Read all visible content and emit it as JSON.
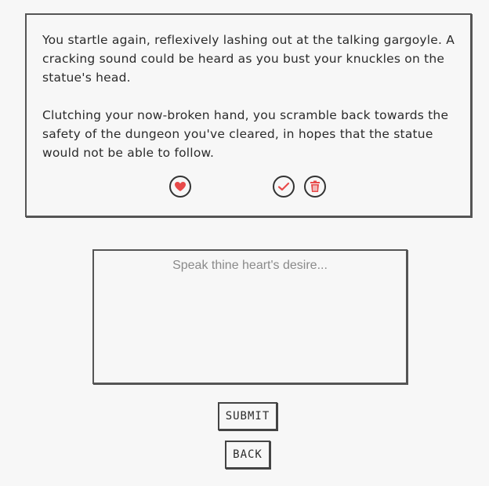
{
  "story": {
    "paragraphs": [
      "You startle again, reflexively lashing out at the talking gargoyle. A cracking sound could be heard as you bust your knuckles on the statue's head.",
      "Clutching your now-broken hand, you scramble back towards the safety of the dungeon you've cleared, in hopes that the statue would not be able to follow."
    ],
    "actions": [
      {
        "icon": "heart-icon",
        "color": "#e84a4a"
      },
      {
        "icon": "check-icon",
        "color": "#e84a4a"
      },
      {
        "icon": "trash-icon",
        "color": "#e84a4a"
      }
    ]
  },
  "prompt": {
    "placeholder": "Speak thine heart's desire...",
    "value": ""
  },
  "buttons": {
    "submit_label": "SUBMIT",
    "back_label": "BACK"
  },
  "colors": {
    "background": "#f7f7f7",
    "accent": "#e84a4a",
    "border": "#555555"
  }
}
